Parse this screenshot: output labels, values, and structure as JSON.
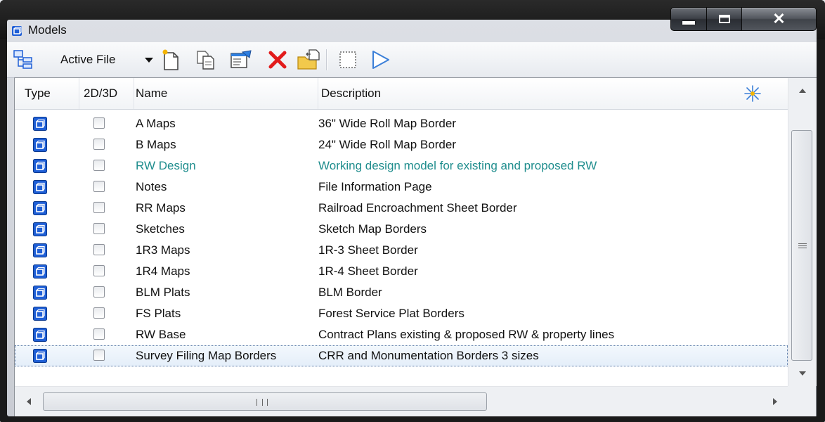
{
  "window": {
    "title": "Models"
  },
  "toolbar": {
    "file_selector": "Active File",
    "buttons": [
      {
        "name": "models-tree-icon"
      },
      {
        "name": "new-model-icon"
      },
      {
        "name": "copy-model-icon"
      },
      {
        "name": "model-properties-icon"
      },
      {
        "name": "delete-icon"
      },
      {
        "name": "import-icon"
      },
      {
        "name": "select-all-icon"
      },
      {
        "name": "arrow-icon"
      }
    ]
  },
  "columns": [
    "Type",
    "2D/3D",
    "Name",
    "Description"
  ],
  "rows": [
    {
      "name": "A Maps",
      "description": "36\" Wide Roll Map Border"
    },
    {
      "name": "B Maps",
      "description": "24\" Wide Roll Map Border"
    },
    {
      "name": "RW Design",
      "description": "Working design model for existing and proposed RW",
      "active": true
    },
    {
      "name": "Notes",
      "description": "File Information Page"
    },
    {
      "name": "RR Maps",
      "description": "Railroad Encroachment Sheet Border"
    },
    {
      "name": "Sketches",
      "description": "Sketch Map Borders"
    },
    {
      "name": "1R3 Maps",
      "description": "1R-3 Sheet Border"
    },
    {
      "name": "1R4 Maps",
      "description": "1R-4 Sheet Border"
    },
    {
      "name": "BLM Plats",
      "description": "BLM Border"
    },
    {
      "name": "FS Plats",
      "description": "Forest Service Plat Borders"
    },
    {
      "name": "RW Base",
      "description": "Contract Plans existing & proposed RW & property lines"
    },
    {
      "name": "Survey Filing Map Borders",
      "description": "CRR and Monumentation Borders 3 sizes",
      "selected": true
    }
  ],
  "colors": {
    "active_row_text": "#1f8d8d",
    "icon_blue": "#1f5fd6"
  }
}
